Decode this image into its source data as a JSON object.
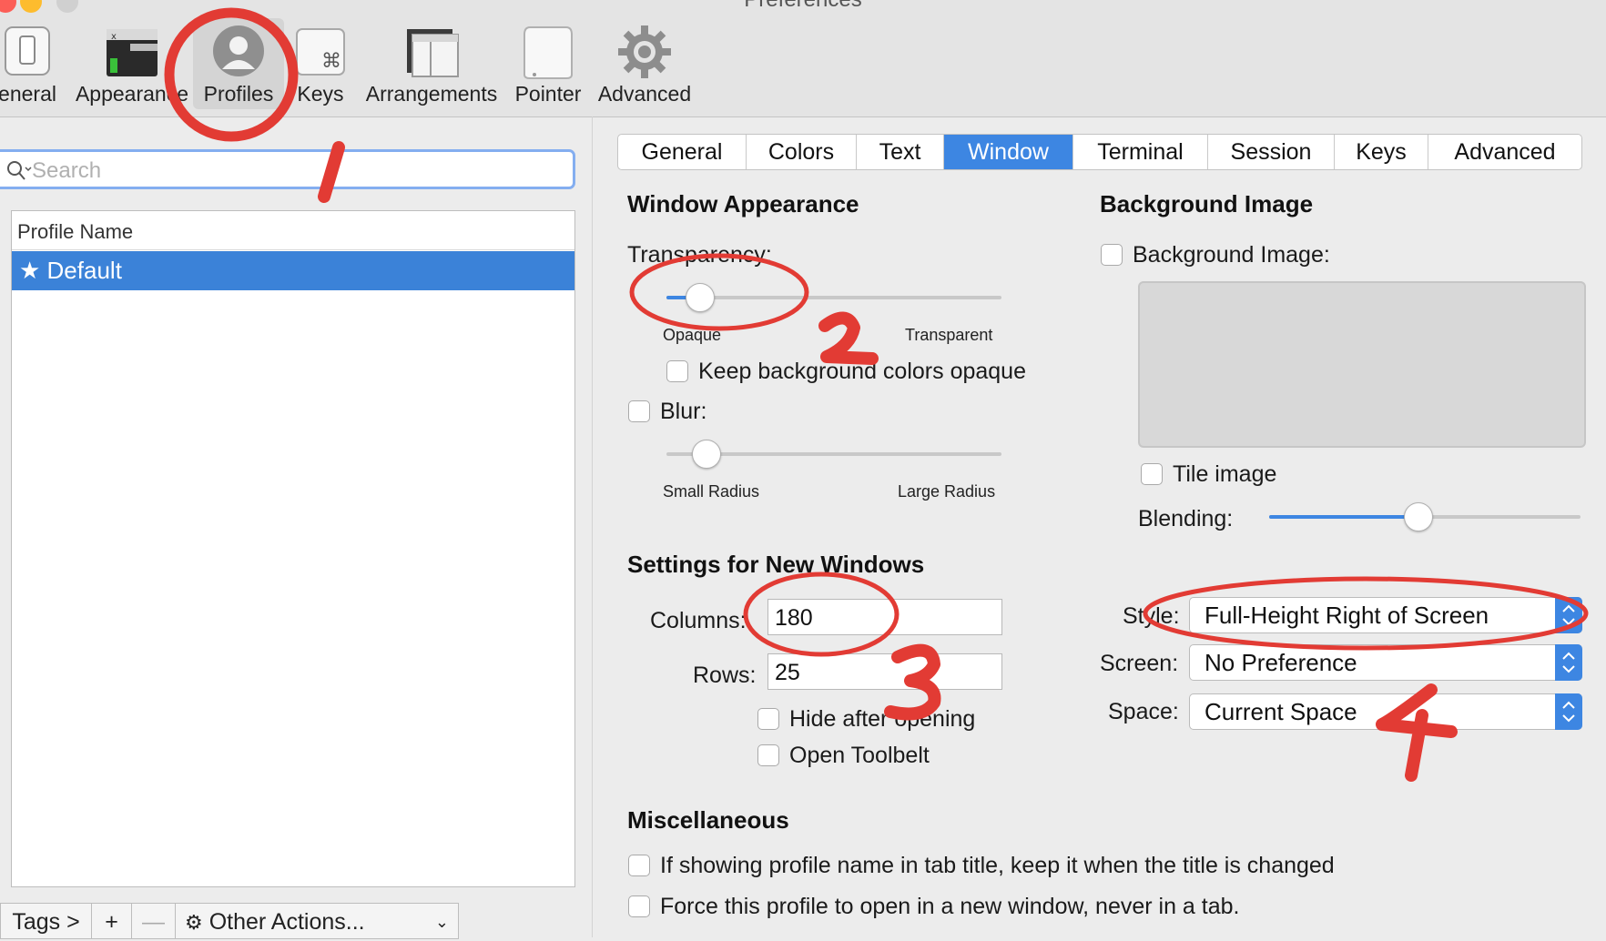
{
  "window": {
    "title": "Preferences"
  },
  "toolbar": {
    "items": [
      {
        "label": "eneral",
        "icon": "general-switch-icon"
      },
      {
        "label": "Appearance",
        "icon": "terminal-window-icon"
      },
      {
        "label": "Profiles",
        "icon": "user-silhouette-icon"
      },
      {
        "label": "Keys",
        "icon": "command-key-icon"
      },
      {
        "label": "Arrangements",
        "icon": "window-arrangement-icon"
      },
      {
        "label": "Pointer",
        "icon": "mouse-icon"
      },
      {
        "label": "Advanced",
        "icon": "gear-icon"
      }
    ],
    "selected": "Profiles"
  },
  "sidebar": {
    "search_placeholder": "Search",
    "column_header": "Profile Name",
    "profiles": [
      {
        "label": "★ Default",
        "selected": true
      }
    ],
    "bottom_bar": {
      "tags": "Tags >",
      "add": "+",
      "remove": "—",
      "other_actions": "Other Actions..."
    }
  },
  "tabs": {
    "items": [
      "General",
      "Colors",
      "Text",
      "Window",
      "Terminal",
      "Session",
      "Keys",
      "Advanced"
    ],
    "selected": "Window"
  },
  "window_appearance": {
    "heading": "Window Appearance",
    "transparency_label": "Transparency:",
    "transparency_value": 0.1,
    "opaque_label": "Opaque",
    "transparent_label": "Transparent",
    "keep_bg_opaque_label": "Keep background colors opaque",
    "keep_bg_opaque_checked": false,
    "blur_label": "Blur:",
    "blur_checked": false,
    "blur_value": 0.12,
    "small_radius_label": "Small Radius",
    "large_radius_label": "Large Radius"
  },
  "background_image": {
    "heading": "Background Image",
    "checkbox_label": "Background Image:",
    "checked": false,
    "tile_label": "Tile image",
    "tile_checked": false,
    "blending_label": "Blending:",
    "blending_value": 0.48
  },
  "new_windows": {
    "heading": "Settings for New Windows",
    "columns_label": "Columns:",
    "columns_value": "180",
    "rows_label": "Rows:",
    "rows_value": "25",
    "hide_after_opening_label": "Hide after opening",
    "open_toolbelt_label": "Open Toolbelt",
    "style_label": "Style:",
    "style_value": "Full-Height Right of Screen",
    "screen_label": "Screen:",
    "screen_value": "No Preference",
    "space_label": "Space:",
    "space_value": "Current Space"
  },
  "miscellaneous": {
    "heading": "Miscellaneous",
    "keep_profile_name_label": "If showing profile name in tab title, keep it when the title is changed",
    "force_new_window_label": "Force this profile to open in a new window, never in a tab."
  },
  "annotations": {
    "color": "#e23b34",
    "numbers": [
      "1",
      "2",
      "3",
      "4"
    ]
  },
  "colors": {
    "accent": "#3d86e2",
    "selection": "#3b82d8",
    "annotation": "#e23b34"
  }
}
